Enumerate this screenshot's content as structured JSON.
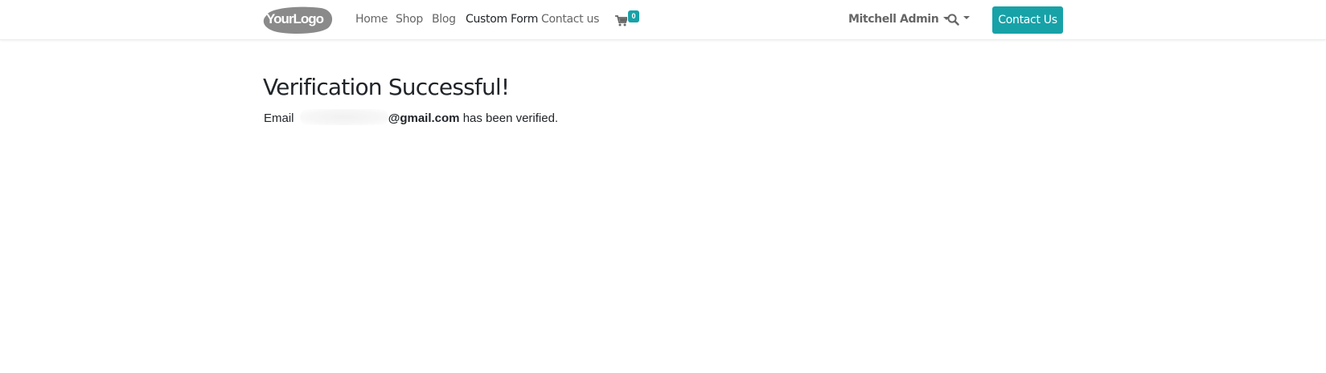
{
  "header": {
    "logo_text": "YourLogo",
    "nav": [
      {
        "label": "Home",
        "active": false
      },
      {
        "label": "Shop",
        "active": false
      },
      {
        "label": "Blog",
        "active": false
      },
      {
        "label": "Custom Form",
        "active": true
      },
      {
        "label": "Contact us",
        "active": false
      }
    ],
    "cart": {
      "icon": "shopping-cart-icon",
      "count": "0"
    },
    "user_name": "Mitchell Admin",
    "search_icon": "search-icon",
    "cta_label": "Contact Us"
  },
  "main": {
    "title": "Verification Successful!",
    "message_prefix": "Email",
    "email_domain": "@gmail.com",
    "message_suffix": "has been verified."
  },
  "colors": {
    "accent": "#17a2a8",
    "text": "#212529",
    "nav_text": "#666666"
  }
}
